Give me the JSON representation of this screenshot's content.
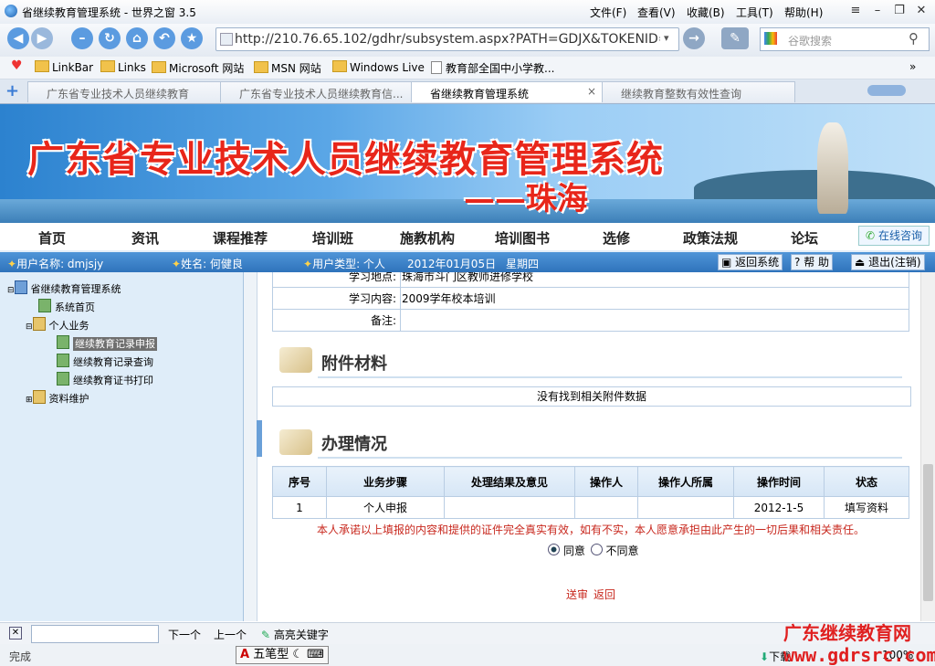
{
  "window": {
    "title": "省继续教育管理系统 - 世界之窗 3.5",
    "menus": [
      "文件(F)",
      "查看(V)",
      "收藏(B)",
      "工具(T)",
      "帮助(H)"
    ]
  },
  "address": {
    "url": "http://210.76.65.102/gdhr/subsystem.aspx?PATH=GDJX&TOKENID=d",
    "search_placeholder": "谷歌搜索"
  },
  "favorites": [
    "LinkBar",
    "Links",
    "Microsoft 网站",
    "MSN 网站",
    "Windows Live",
    "教育部全国中小学教..."
  ],
  "tabs": [
    {
      "label": "广东省专业技术人员继续教育",
      "active": false
    },
    {
      "label": "广东省专业技术人员继续教育信...",
      "active": false
    },
    {
      "label": "省继续教育管理系统",
      "active": true
    },
    {
      "label": "继续教育整数有效性查询",
      "active": false
    }
  ],
  "banner": {
    "title": "广东省专业技术人员继续教育管理系统",
    "subtitle": "——珠海"
  },
  "site_nav": [
    "首页",
    "资讯",
    "课程推荐",
    "培训班",
    "施教机构",
    "培训图书",
    "选修",
    "政策法规",
    "论坛"
  ],
  "online_consult": "在线咨询",
  "user": {
    "account": "用户名称: dmjsjy",
    "name": "姓名: 何健良",
    "type": "用户类型: 个人",
    "date": "2012年01月05日",
    "weekday": "星期四",
    "back_label": "返回系统",
    "help_label": "帮 助",
    "logout_label": "退出(注销)"
  },
  "tree": {
    "root": "省继续教育管理系统",
    "home": "系统首页",
    "personal": "个人业务",
    "items": [
      "继续教育记录申报",
      "继续教育记录查询",
      "继续教育证书打印"
    ],
    "maintenance": "资料维护"
  },
  "info": {
    "rows": [
      {
        "label": "学习地点:",
        "value": "珠海市斗门区教师进修学校"
      },
      {
        "label": "学习内容:",
        "value": "2009学年校本培训"
      },
      {
        "label": "备注:",
        "value": ""
      }
    ]
  },
  "attachments": {
    "title": "附件材料",
    "empty": "没有找到相关附件数据"
  },
  "process": {
    "title": "办理情况",
    "headers": [
      "序号",
      "业务步骤",
      "处理结果及意见",
      "操作人",
      "操作人所属",
      "操作时间",
      "状态"
    ],
    "rows": [
      [
        "1",
        "个人申报",
        "",
        "",
        "",
        "2012-1-5",
        "填写资料"
      ]
    ]
  },
  "declaration": "本人承诺以上填报的内容和提供的证件完全真实有效，如有不实，本人愿意承担由此产生的一切后果和相关责任。",
  "agree": "同意",
  "disagree": "不同意",
  "actions": {
    "submit": "送审",
    "back": "返回"
  },
  "findbar": {
    "next": "下一个",
    "prev": "上一个",
    "highlight": "高亮关键字"
  },
  "status": {
    "text": "完成",
    "download": "下载",
    "zoom": "100%",
    "ime": "五笔型"
  },
  "watermark": {
    "line1": "广东继续教育网",
    "line2": "www.gdrsrc.com"
  }
}
